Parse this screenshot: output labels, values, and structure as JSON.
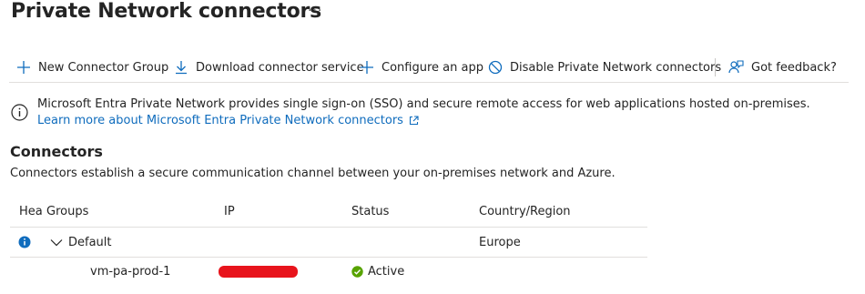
{
  "page": {
    "title": "Private Network connectors",
    "more_label": "···"
  },
  "toolbar": {
    "new_group": "New Connector Group",
    "download": "Download connector service",
    "configure": "Configure an app",
    "disable": "Disable Private Network connectors",
    "feedback": "Got feedback?"
  },
  "info": {
    "text": "Microsoft Entra Private Network provides single sign-on (SSO) and secure remote access for web applications hosted on-premises.",
    "link": "Learn more about Microsoft Entra Private Network connectors"
  },
  "connectors": {
    "title": "Connectors",
    "description": "Connectors establish a secure communication channel between your on-premises network and Azure."
  },
  "table": {
    "columns": {
      "health": "Health",
      "groups": "Groups",
      "ip": "IP",
      "status": "Status",
      "country": "Country/Region"
    },
    "group_row": {
      "name": "Default",
      "country": "Europe"
    },
    "connector_row": {
      "name": "vm-pa-prod-1",
      "status": "Active"
    }
  },
  "colors": {
    "accent_blue": "#0f6cbd",
    "info_blue": "#0f6cbd",
    "active_green": "#57a300",
    "redaction_red": "#e8141c"
  },
  "icons": {
    "toolbar": [
      "plus-icon",
      "download-icon",
      "plus-icon",
      "block-icon",
      "feedback-icon"
    ],
    "info": "info-icon",
    "external_link": "external-link-icon",
    "row_info": "info-filled-icon",
    "expander": "chevron-down-icon",
    "status": "check-circle-icon"
  }
}
